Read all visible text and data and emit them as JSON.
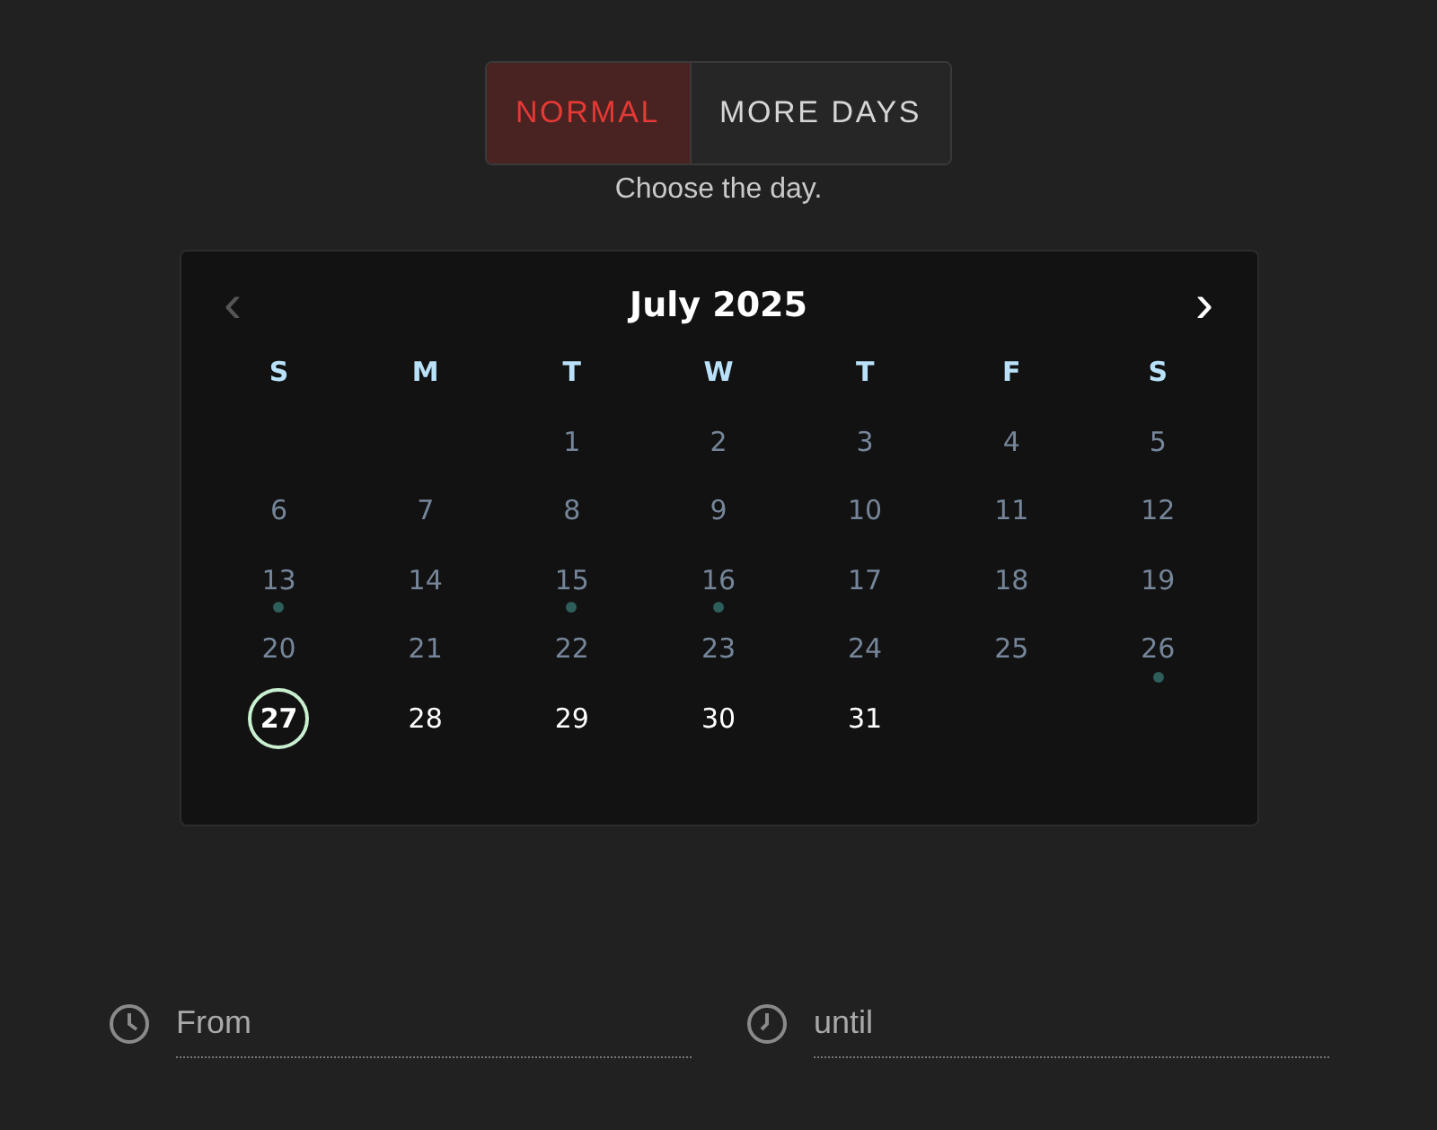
{
  "mode_toggle": [
    {
      "label": "NORMAL",
      "selected": true
    },
    {
      "label": "MORE DAYS",
      "selected": false
    }
  ],
  "caption": "Choose the day.",
  "calendar": {
    "title": "July 2025",
    "prev": {
      "label": "‹",
      "disabled": true
    },
    "next": {
      "label": "›",
      "disabled": false
    },
    "weekdays": [
      "S",
      "M",
      "T",
      "W",
      "T",
      "F",
      "S"
    ],
    "weeks": [
      {
        "right_aligned": true,
        "days": [
          {
            "day": "1",
            "past": true,
            "today": false,
            "event": false
          },
          {
            "day": "2",
            "past": true,
            "today": false,
            "event": false
          },
          {
            "day": "3",
            "past": true,
            "today": false,
            "event": false
          },
          {
            "day": "4",
            "past": true,
            "today": false,
            "event": false
          },
          {
            "day": "5",
            "past": true,
            "today": false,
            "event": false
          }
        ]
      },
      {
        "right_aligned": false,
        "days": [
          {
            "day": "6",
            "past": true,
            "today": false,
            "event": false
          },
          {
            "day": "7",
            "past": true,
            "today": false,
            "event": false
          },
          {
            "day": "8",
            "past": true,
            "today": false,
            "event": false
          },
          {
            "day": "9",
            "past": true,
            "today": false,
            "event": false
          },
          {
            "day": "10",
            "past": true,
            "today": false,
            "event": false
          },
          {
            "day": "11",
            "past": true,
            "today": false,
            "event": false
          },
          {
            "day": "12",
            "past": true,
            "today": false,
            "event": false
          }
        ]
      },
      {
        "right_aligned": false,
        "days": [
          {
            "day": "13",
            "past": true,
            "today": false,
            "event": true
          },
          {
            "day": "14",
            "past": true,
            "today": false,
            "event": false
          },
          {
            "day": "15",
            "past": true,
            "today": false,
            "event": true
          },
          {
            "day": "16",
            "past": true,
            "today": false,
            "event": true
          },
          {
            "day": "17",
            "past": true,
            "today": false,
            "event": false
          },
          {
            "day": "18",
            "past": true,
            "today": false,
            "event": false
          },
          {
            "day": "19",
            "past": true,
            "today": false,
            "event": false
          }
        ]
      },
      {
        "right_aligned": false,
        "days": [
          {
            "day": "20",
            "past": true,
            "today": false,
            "event": false
          },
          {
            "day": "21",
            "past": true,
            "today": false,
            "event": false
          },
          {
            "day": "22",
            "past": true,
            "today": false,
            "event": false
          },
          {
            "day": "23",
            "past": true,
            "today": false,
            "event": false
          },
          {
            "day": "24",
            "past": true,
            "today": false,
            "event": false
          },
          {
            "day": "25",
            "past": true,
            "today": false,
            "event": false
          },
          {
            "day": "26",
            "past": true,
            "today": false,
            "event": true
          }
        ]
      },
      {
        "right_aligned": false,
        "days": [
          {
            "day": "27",
            "past": false,
            "today": true,
            "event": false
          },
          {
            "day": "28",
            "past": false,
            "today": false,
            "event": false
          },
          {
            "day": "29",
            "past": false,
            "today": false,
            "event": false
          },
          {
            "day": "30",
            "past": false,
            "today": false,
            "event": false
          },
          {
            "day": "31",
            "past": false,
            "today": false,
            "event": false
          }
        ]
      }
    ]
  },
  "time_fields": [
    {
      "placeholder": "From"
    },
    {
      "placeholder": "until"
    }
  ]
}
